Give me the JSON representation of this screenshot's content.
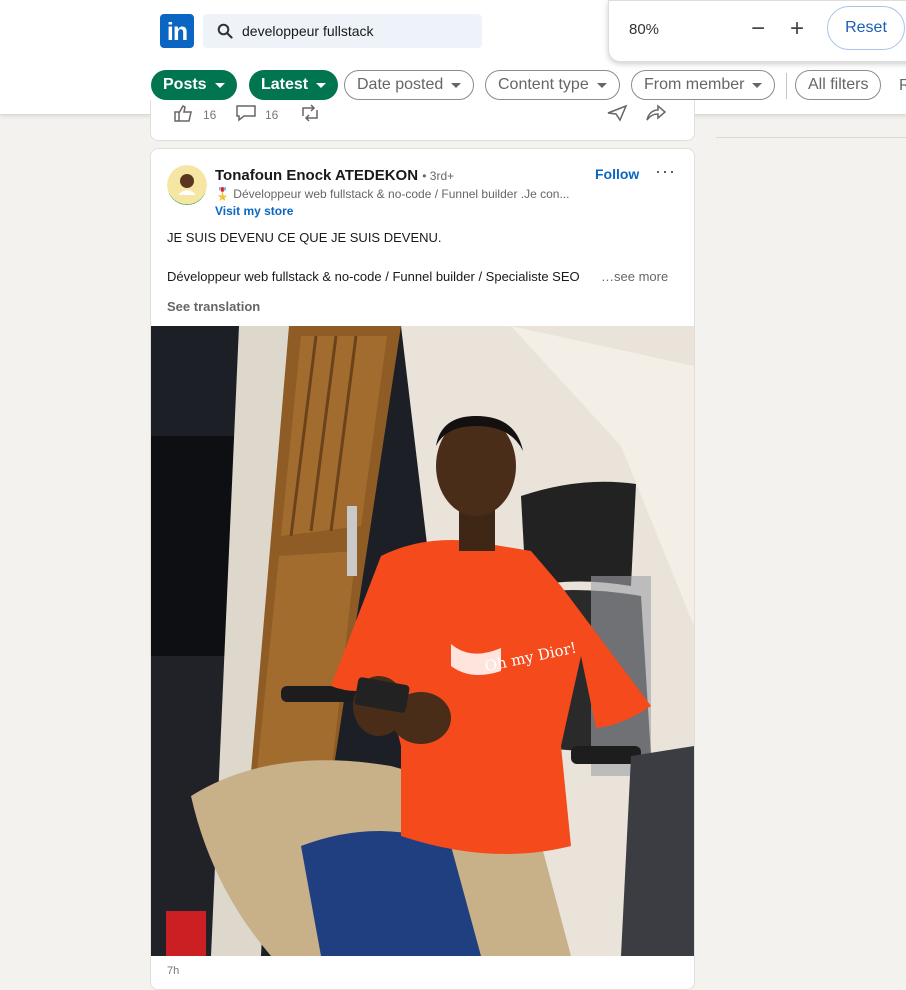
{
  "search": {
    "value": "developpeur fullstack"
  },
  "zoom": {
    "level": "80%",
    "minus": "−",
    "plus": "+",
    "reset_label": "Reset"
  },
  "filters": {
    "posts": "Posts",
    "latest": "Latest",
    "date_posted": "Date posted",
    "content_type": "Content type",
    "from_member": "From member",
    "all_filters": "All filters",
    "truncated": "R"
  },
  "prev_post": {
    "reaction_count": "16",
    "comment_count": "16"
  },
  "post": {
    "author": "Tonafoun Enock ATEDEKON",
    "degree": "• 3rd+",
    "headline": "🎖️ Développeur web fullstack & no-code / Funnel builder .Je con...",
    "store_link": "Visit my store",
    "follow_label": "Follow",
    "menu": "···",
    "line1": "JE SUIS DEVENU CE QUE JE SUIS DEVENU.",
    "line2": "Développeur web fullstack & no-code / Funnel builder / Specialiste SEO",
    "see_more": "…see more",
    "see_translation": "See translation",
    "shirt_text": "Oh my Dior!",
    "time": "7h"
  },
  "colors": {
    "linkedin_blue": "#0a66c2",
    "green_pill": "#01754f",
    "background": "#f4f2ee"
  }
}
